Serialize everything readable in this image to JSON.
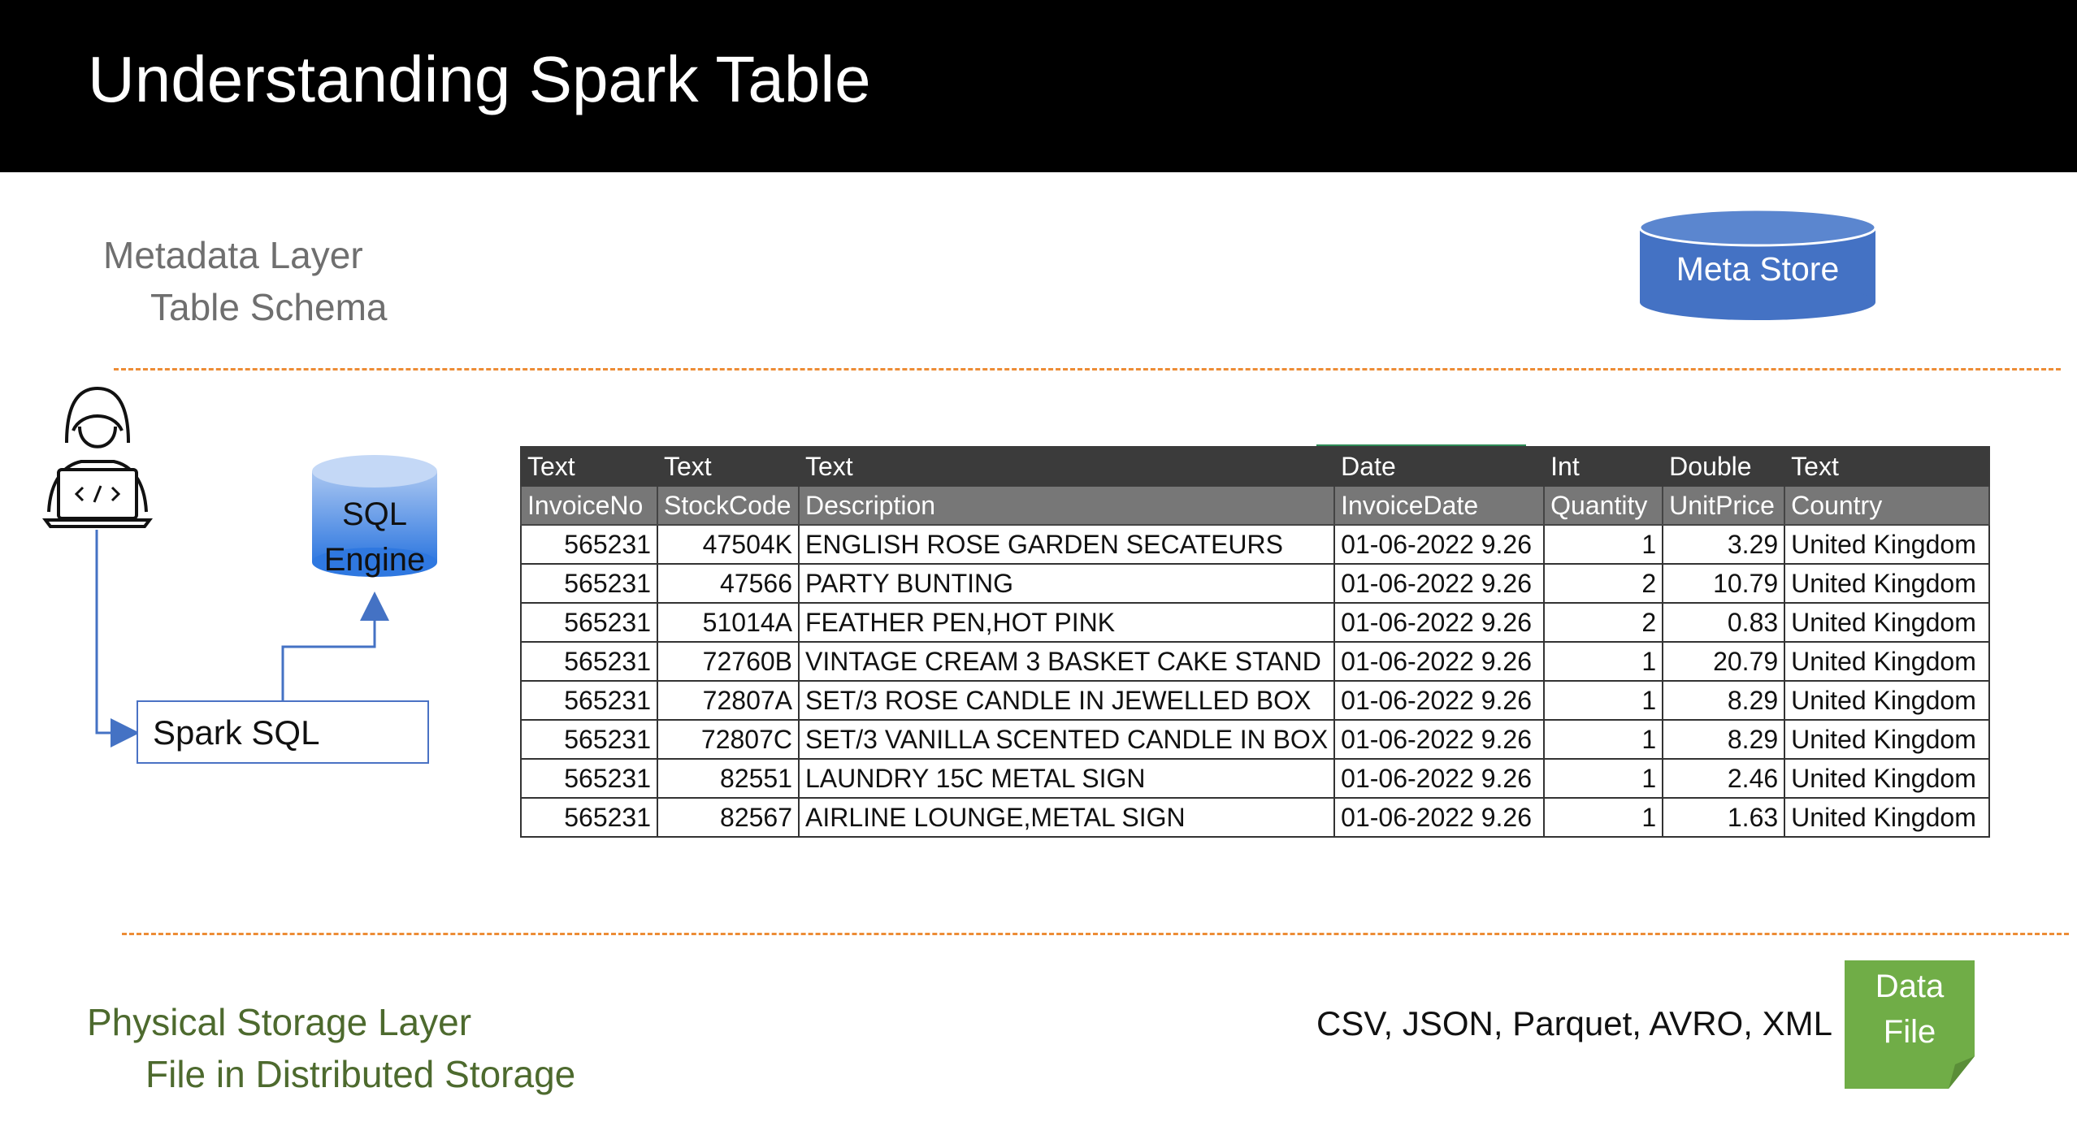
{
  "slide": {
    "title": "Understanding Spark Table"
  },
  "metadata_layer": {
    "line1": "Metadata Layer",
    "line2": "Table Schema"
  },
  "meta_store": {
    "label": "Meta Store"
  },
  "sql_engine": {
    "line1": "SQL",
    "line2": "Engine"
  },
  "spark_sql": {
    "label": "Spark SQL"
  },
  "table": {
    "types": [
      "Text",
      "Text",
      "Text",
      "Date",
      "Int",
      "Double",
      "Text"
    ],
    "columns": [
      "InvoiceNo",
      "StockCode",
      "Description",
      "InvoiceDate",
      "Quantity",
      "UnitPrice",
      "Country"
    ],
    "rows": [
      [
        "565231",
        "47504K",
        "ENGLISH ROSE GARDEN SECATEURS",
        "01-06-2022 9.26",
        "1",
        "3.29",
        "United Kingdom"
      ],
      [
        "565231",
        "47566",
        "PARTY BUNTING",
        "01-06-2022 9.26",
        "2",
        "10.79",
        "United Kingdom"
      ],
      [
        "565231",
        "51014A",
        "FEATHER PEN,HOT PINK",
        "01-06-2022 9.26",
        "2",
        "0.83",
        "United Kingdom"
      ],
      [
        "565231",
        "72760B",
        "VINTAGE CREAM 3 BASKET CAKE STAND",
        "01-06-2022 9.26",
        "1",
        "20.79",
        "United Kingdom"
      ],
      [
        "565231",
        "72807A",
        "SET/3 ROSE CANDLE IN JEWELLED BOX",
        "01-06-2022 9.26",
        "1",
        "8.29",
        "United Kingdom"
      ],
      [
        "565231",
        "72807C",
        "SET/3 VANILLA SCENTED CANDLE IN BOX",
        "01-06-2022 9.26",
        "1",
        "8.29",
        "United Kingdom"
      ],
      [
        "565231",
        "82551",
        "LAUNDRY 15C METAL SIGN",
        "01-06-2022 9.26",
        "1",
        "2.46",
        "United Kingdom"
      ],
      [
        "565231",
        "82567",
        "AIRLINE LOUNGE,METAL SIGN",
        "01-06-2022 9.26",
        "1",
        "1.63",
        "United Kingdom"
      ]
    ]
  },
  "storage_layer": {
    "line1": "Physical Storage Layer",
    "line2": "File in Distributed Storage"
  },
  "file_formats": "CSV, JSON, Parquet, AVRO, XML",
  "data_file": {
    "line1": "Data",
    "line2": "File"
  },
  "colors": {
    "accent_blue": "#4472c4",
    "dashed_orange": "#ed8c35",
    "storage_green": "#4d6a2e",
    "file_green": "#70ad47"
  },
  "icons": [
    "developer-laptop-icon",
    "database-cylinder-icon",
    "document-icon"
  ]
}
